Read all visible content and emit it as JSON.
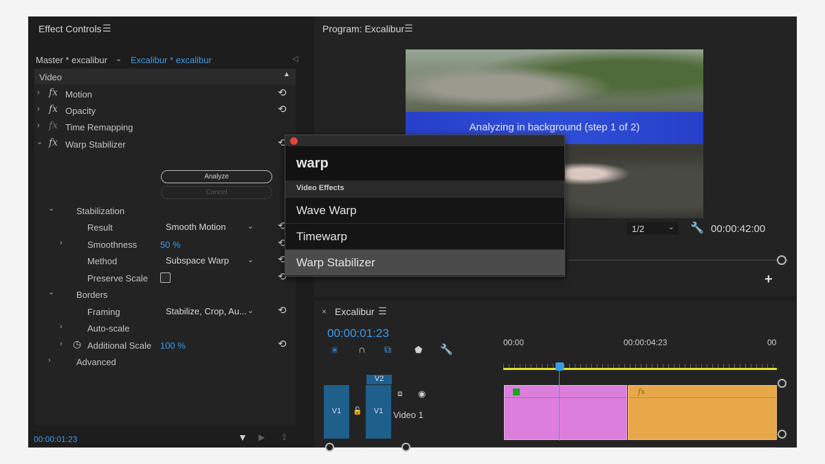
{
  "effect_controls": {
    "title": "Effect Controls",
    "tab_master": "Master * excalibur",
    "tab_active": "Excalibur * excalibur",
    "section": "Video",
    "effects": {
      "motion": "Motion",
      "opacity": "Opacity",
      "time_remapping": "Time Remapping",
      "warp_stabilizer": "Warp Stabilizer"
    },
    "analyze_label": "Analyze",
    "cancel_label": "Cancel",
    "stabilization": "Stabilization",
    "result_label": "Result",
    "result_value": "Smooth Motion",
    "smoothness_label": "Smoothness",
    "smoothness_value": "50 %",
    "method_label": "Method",
    "method_value": "Subspace Warp",
    "preserve_scale_label": "Preserve Scale",
    "borders": "Borders",
    "framing_label": "Framing",
    "framing_value": "Stabilize, Crop, Au...",
    "auto_scale_label": "Auto-scale",
    "additional_scale_label": "Additional Scale",
    "additional_scale_value": "100 %",
    "advanced_label": "Advanced",
    "timecode": "00:00:01:23"
  },
  "program": {
    "title": "Program: Excalibur",
    "banner_text": "Analyzing in background (step 1 of 2)",
    "resolution": "1/2",
    "timecode": "00:00:42:00"
  },
  "popup": {
    "query": "warp",
    "category": "Video Effects",
    "items": [
      "Wave Warp",
      "Timewarp",
      "Warp Stabilizer"
    ]
  },
  "timeline": {
    "tab": "Excalibur",
    "timecode": "00:00:01:23",
    "ruler": [
      "00:00",
      "00:00:04:23",
      "00"
    ],
    "v2": "V2",
    "v1_source": "V1",
    "v1_target": "V1",
    "track_name": "Video 1",
    "fx_badge": "fx"
  },
  "colors": {
    "accent_blue": "#3a9bea",
    "clip_pink": "#dc7fdc",
    "clip_orange": "#e8a84a",
    "track_blue": "#1e5f8c",
    "banner_blue": "#2f4ed8"
  }
}
